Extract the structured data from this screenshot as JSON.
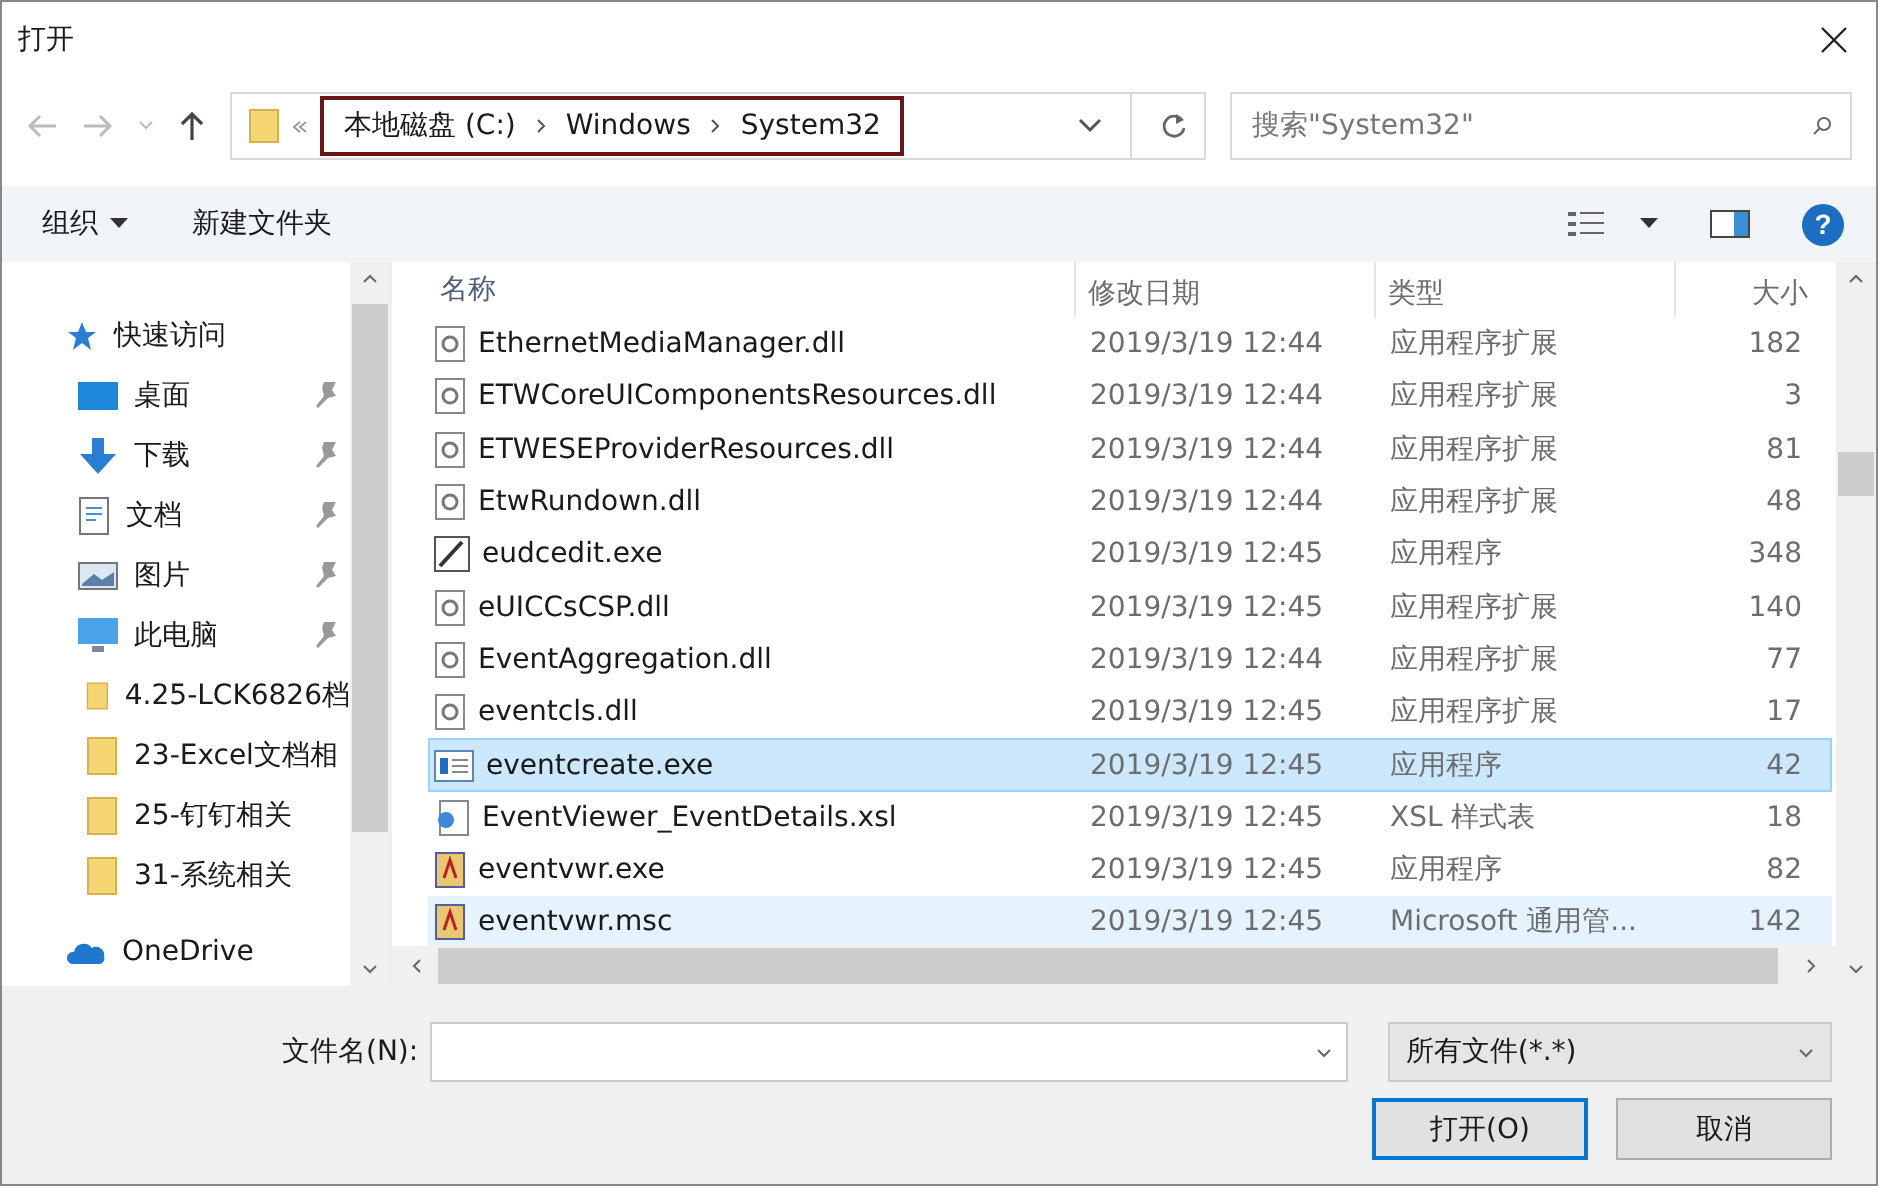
{
  "window": {
    "title": "打开"
  },
  "address": {
    "crumbs": [
      "本地磁盘 (C:)",
      "Windows",
      "System32"
    ],
    "highlighted": true
  },
  "search": {
    "placeholder": "搜索\"System32\""
  },
  "toolbar": {
    "organize": "组织",
    "new_folder": "新建文件夹",
    "help": "?"
  },
  "sidebar": {
    "items": [
      {
        "label": "快速访问",
        "kind": "star",
        "pinned": false
      },
      {
        "label": "桌面",
        "kind": "desktop",
        "pinned": true
      },
      {
        "label": "下载",
        "kind": "download",
        "pinned": true
      },
      {
        "label": "文档",
        "kind": "document",
        "pinned": true
      },
      {
        "label": "图片",
        "kind": "picture",
        "pinned": true
      },
      {
        "label": "此电脑",
        "kind": "pc",
        "pinned": true
      },
      {
        "label": "4.25-LCK6826档",
        "kind": "folder",
        "pinned": false
      },
      {
        "label": "23-Excel文档相",
        "kind": "folder",
        "pinned": false
      },
      {
        "label": "25-钉钉相关",
        "kind": "folder",
        "pinned": false
      },
      {
        "label": "31-系统相关",
        "kind": "folder",
        "pinned": false
      },
      {
        "label": "OneDrive",
        "kind": "cloud",
        "pinned": false
      }
    ]
  },
  "table": {
    "columns": [
      "名称",
      "修改日期",
      "类型",
      "大小"
    ],
    "rows": [
      {
        "name": "EthernetMediaManager.dll",
        "date": "2019/3/19 12:44",
        "type": "应用程序扩展",
        "size": "182",
        "kind": "dll",
        "selected": false,
        "hovered": false
      },
      {
        "name": "ETWCoreUIComponentsResources.dll",
        "date": "2019/3/19 12:44",
        "type": "应用程序扩展",
        "size": "3",
        "kind": "dll",
        "selected": false,
        "hovered": false
      },
      {
        "name": "ETWESEProviderResources.dll",
        "date": "2019/3/19 12:44",
        "type": "应用程序扩展",
        "size": "81",
        "kind": "dll",
        "selected": false,
        "hovered": false
      },
      {
        "name": "EtwRundown.dll",
        "date": "2019/3/19 12:44",
        "type": "应用程序扩展",
        "size": "48",
        "kind": "dll",
        "selected": false,
        "hovered": false
      },
      {
        "name": "eudcedit.exe",
        "date": "2019/3/19 12:45",
        "type": "应用程序",
        "size": "348",
        "kind": "pen",
        "selected": false,
        "hovered": false
      },
      {
        "name": "eUICCsCSP.dll",
        "date": "2019/3/19 12:45",
        "type": "应用程序扩展",
        "size": "140",
        "kind": "dll",
        "selected": false,
        "hovered": false
      },
      {
        "name": "EventAggregation.dll",
        "date": "2019/3/19 12:44",
        "type": "应用程序扩展",
        "size": "77",
        "kind": "dll",
        "selected": false,
        "hovered": false
      },
      {
        "name": "eventcls.dll",
        "date": "2019/3/19 12:45",
        "type": "应用程序扩展",
        "size": "17",
        "kind": "dll",
        "selected": false,
        "hovered": false
      },
      {
        "name": "eventcreate.exe",
        "date": "2019/3/19 12:45",
        "type": "应用程序",
        "size": "42",
        "kind": "window",
        "selected": true,
        "hovered": false
      },
      {
        "name": "EventViewer_EventDetails.xsl",
        "date": "2019/3/19 12:45",
        "type": "XSL 样式表",
        "size": "18",
        "kind": "xsl",
        "selected": false,
        "hovered": false
      },
      {
        "name": "eventvwr.exe",
        "date": "2019/3/19 12:45",
        "type": "应用程序",
        "size": "82",
        "kind": "book",
        "selected": false,
        "hovered": false
      },
      {
        "name": "eventvwr.msc",
        "date": "2019/3/19 12:45",
        "type": "Microsoft 通用管...",
        "size": "142",
        "kind": "book",
        "selected": false,
        "hovered": true
      }
    ]
  },
  "footer": {
    "filename_label": "文件名(N):",
    "filter": "所有文件(*.*)",
    "open": "打开(O)",
    "cancel": "取消"
  }
}
